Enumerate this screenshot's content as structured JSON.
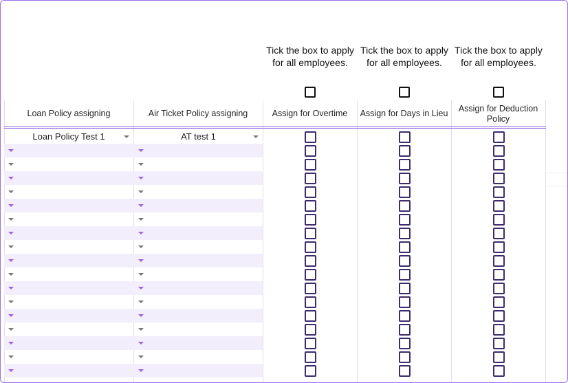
{
  "tick_notes": [
    "Tick the box to apply for all employees.",
    "Tick the box to apply for all employees.",
    "Tick the box to apply for all employees."
  ],
  "headers": {
    "loan": "Loan Policy assigning",
    "air": "Air Ticket Policy assigning",
    "overtime": "Assign for Overtime",
    "days_in_lieu": "Assign for Days in Lieu",
    "deduction": "Assign for Deduction Policy"
  },
  "rows": [
    {
      "loan": "Loan Policy Test 1",
      "air": "AT test 1"
    },
    {
      "loan": "",
      "air": ""
    },
    {
      "loan": "",
      "air": ""
    },
    {
      "loan": "",
      "air": ""
    },
    {
      "loan": "",
      "air": ""
    },
    {
      "loan": "",
      "air": ""
    },
    {
      "loan": "",
      "air": ""
    },
    {
      "loan": "",
      "air": ""
    },
    {
      "loan": "",
      "air": ""
    },
    {
      "loan": "",
      "air": ""
    },
    {
      "loan": "",
      "air": ""
    },
    {
      "loan": "",
      "air": ""
    },
    {
      "loan": "",
      "air": ""
    },
    {
      "loan": "",
      "air": ""
    },
    {
      "loan": "",
      "air": ""
    },
    {
      "loan": "",
      "air": ""
    },
    {
      "loan": "",
      "air": ""
    },
    {
      "loan": "",
      "air": ""
    }
  ],
  "colors": {
    "accent": "#8e5fe0",
    "alt_row": "#f3eefc",
    "checkbox": "#3e2a6c"
  }
}
